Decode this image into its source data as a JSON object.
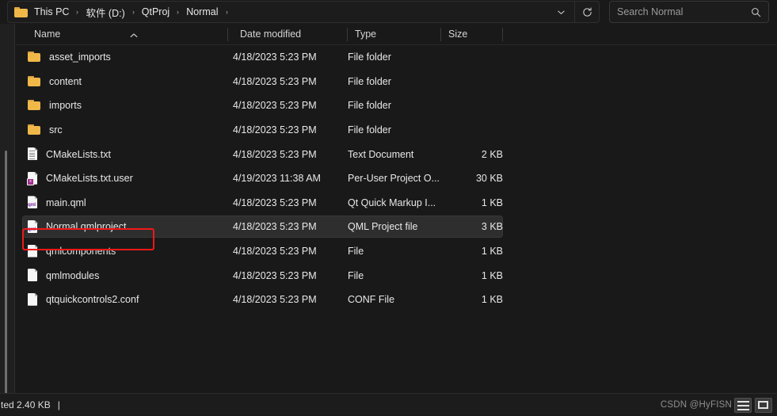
{
  "window": {
    "title": "Normal"
  },
  "address_bar": {
    "folder_icon": "folder-icon",
    "breadcrumbs": [
      {
        "label": "This PC"
      },
      {
        "label": "软件 (D:)"
      },
      {
        "label": "QtProj"
      },
      {
        "label": "Normal"
      }
    ],
    "separator": "›",
    "dropdown_icon": "chevron-down-icon",
    "refresh_icon": "refresh-icon"
  },
  "search": {
    "placeholder": "Search Normal",
    "value": "",
    "icon": "search-icon"
  },
  "columns": [
    {
      "key": "name",
      "label": "Name",
      "sorted": "asc"
    },
    {
      "key": "date",
      "label": "Date modified"
    },
    {
      "key": "type",
      "label": "Type"
    },
    {
      "key": "size",
      "label": "Size"
    }
  ],
  "sort_icon": "sort-ascending-icon",
  "files": [
    {
      "name": "asset_imports",
      "date": "4/18/2023 5:23 PM",
      "type": "File folder",
      "size": "",
      "icon": "folder-icon",
      "selected": false
    },
    {
      "name": "content",
      "date": "4/18/2023 5:23 PM",
      "type": "File folder",
      "size": "",
      "icon": "folder-icon",
      "selected": false
    },
    {
      "name": "imports",
      "date": "4/18/2023 5:23 PM",
      "type": "File folder",
      "size": "",
      "icon": "folder-icon",
      "selected": false
    },
    {
      "name": "src",
      "date": "4/18/2023 5:23 PM",
      "type": "File folder",
      "size": "",
      "icon": "folder-icon",
      "selected": false
    },
    {
      "name": "CMakeLists.txt",
      "date": "4/18/2023 5:23 PM",
      "type": "Text Document",
      "size": "2 KB",
      "icon": "text-document-icon",
      "selected": false
    },
    {
      "name": "CMakeLists.txt.user",
      "date": "4/19/2023 11:38 AM",
      "type": "Per-User Project O...",
      "size": "30 KB",
      "icon": "xml-file-icon",
      "selected": false
    },
    {
      "name": "main.qml",
      "date": "4/18/2023 5:23 PM",
      "type": "Qt Quick Markup I...",
      "size": "1 KB",
      "icon": "qml-file-icon",
      "selected": false
    },
    {
      "name": "Normal.qmlproject",
      "date": "4/18/2023 5:23 PM",
      "type": "QML Project file",
      "size": "3 KB",
      "icon": "qml-file-icon",
      "selected": true
    },
    {
      "name": "qmlcomponents",
      "date": "4/18/2023 5:23 PM",
      "type": "File",
      "size": "1 KB",
      "icon": "blank-file-icon",
      "selected": false
    },
    {
      "name": "qmlmodules",
      "date": "4/18/2023 5:23 PM",
      "type": "File",
      "size": "1 KB",
      "icon": "blank-file-icon",
      "selected": false
    },
    {
      "name": "qtquickcontrols2.conf",
      "date": "4/18/2023 5:23 PM",
      "type": "CONF File",
      "size": "1 KB",
      "icon": "blank-file-icon",
      "selected": false
    }
  ],
  "annotation": {
    "target": "Normal.qmlproject",
    "color": "#f31818"
  },
  "status_bar": {
    "text": "ted  2.40 KB",
    "separator": "|",
    "details_view_icon": "details-view-icon",
    "tiles_view_icon": "tiles-view-icon"
  },
  "watermark": {
    "text": "CSDN @HyFISN"
  },
  "colors": {
    "background": "#191919",
    "selection": "#2e2e2e",
    "folder": "#f0b849",
    "accent_red": "#f31818",
    "qml_purple": "#7a2fa0"
  }
}
